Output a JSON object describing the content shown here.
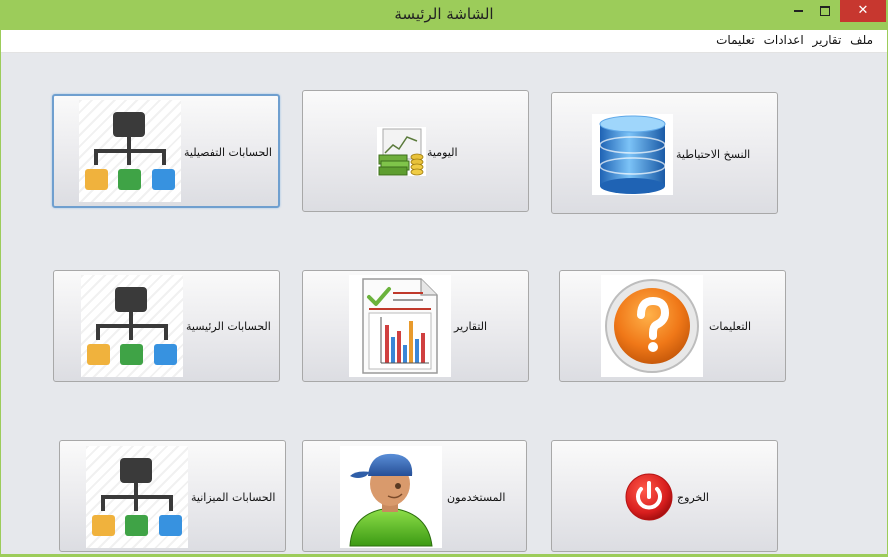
{
  "window": {
    "title": "الشاشة الرئيسة",
    "controls": {
      "minimize": "minimize",
      "maximize": "maximize",
      "close": "✕"
    }
  },
  "menu": {
    "items": [
      "ملف",
      "تقارير",
      "اعدادات",
      "تعليمات"
    ]
  },
  "tiles": {
    "detailed_accounts": {
      "label": "الحسابات التفصيلية",
      "icon": "hierarchy-icon"
    },
    "journal": {
      "label": "اليومية",
      "icon": "money-chart-icon"
    },
    "backup": {
      "label": "النسخ الاحتياطية",
      "icon": "database-icon"
    },
    "main_accounts": {
      "label": "الحسابات الرئيسية",
      "icon": "hierarchy-icon"
    },
    "reports": {
      "label": "التقارير",
      "icon": "report-chart-icon"
    },
    "help": {
      "label": "التعليمات",
      "icon": "help-icon"
    },
    "budget_accounts": {
      "label": "الحسابات الميزانية",
      "icon": "hierarchy-icon"
    },
    "users": {
      "label": "المستخدمون",
      "icon": "user-icon"
    },
    "exit": {
      "label": "الخروج",
      "icon": "power-icon"
    }
  },
  "colors": {
    "titlebar": "#9ccc5a",
    "client": "#e6e8ec",
    "close": "#c7372f",
    "node_dark": "#3a3a3a",
    "node_orange": "#f0b23d",
    "node_green": "#3fa346",
    "node_blue": "#3792e0"
  }
}
